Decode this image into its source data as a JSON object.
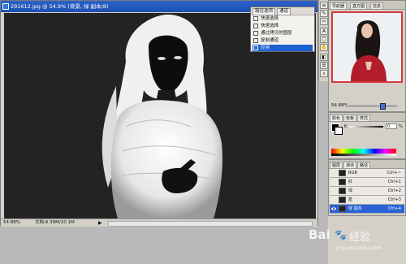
{
  "document": {
    "title": "291612.jpg @ 54.9% (背景, 绿 副本/8)",
    "zoom": "54.88%",
    "info": "文档:6.39M/10.1M",
    "arrow": "▶"
  },
  "context_menu": {
    "tabs": [
      "路径选项",
      "通道"
    ],
    "items": [
      {
        "label": "快速选择",
        "selected": false
      },
      {
        "label": "快速选择",
        "selected": false
      },
      {
        "label": "通过拷贝的图层",
        "selected": false
      },
      {
        "label": "复制通道",
        "selected": false
      },
      {
        "label": "应用",
        "selected": true
      }
    ]
  },
  "tools": [
    "≡",
    "✎",
    "✂",
    "A",
    "▢",
    "✋",
    "◧",
    "☰",
    "⌕"
  ],
  "navigator": {
    "tabs": [
      "导航器",
      "直方图",
      "信息"
    ],
    "zoom": "54.88%"
  },
  "color": {
    "tabs": [
      "颜色",
      "色板",
      "样式"
    ],
    "channel_label": "K",
    "value": "0",
    "unit": "%"
  },
  "channels": {
    "tabs": [
      "图层",
      "通道",
      "路径"
    ],
    "rows": [
      {
        "name": "RGB",
        "key": "Ctrl+~",
        "selected": false
      },
      {
        "name": "红",
        "key": "Ctrl+1",
        "selected": false
      },
      {
        "name": "绿",
        "key": "Ctrl+2",
        "selected": false
      },
      {
        "name": "蓝",
        "key": "Ctrl+3",
        "selected": false
      },
      {
        "name": "绿 副本",
        "key": "Ctrl+4",
        "selected": true
      }
    ]
  },
  "watermark": {
    "brand": "Bai",
    "paw": "🐾",
    "suffix": "经验",
    "url": "jingyan.baidu.com"
  },
  "colors": {
    "title_bar": "#1c4fb1",
    "selection": "#1e5fd1",
    "canvas": "#232323",
    "thumb_border": "#d9393b"
  }
}
